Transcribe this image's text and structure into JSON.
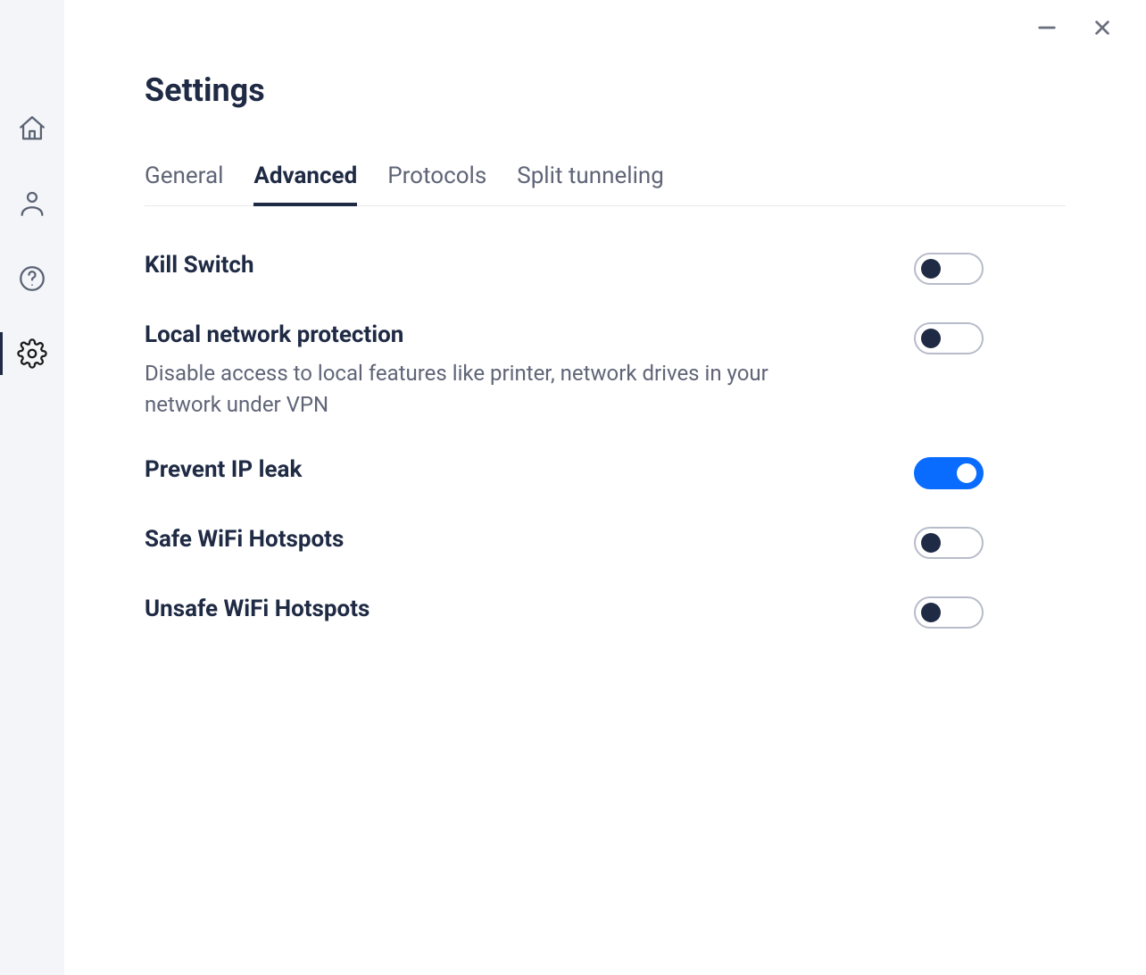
{
  "page": {
    "title": "Settings"
  },
  "tabs": {
    "general": "General",
    "advanced": "Advanced",
    "protocols": "Protocols",
    "split_tunneling": "Split tunneling",
    "active": "advanced"
  },
  "settings": {
    "kill_switch": {
      "title": "Kill Switch",
      "on": false
    },
    "local_network": {
      "title": "Local network protection",
      "desc": "Disable access to local features like printer, network drives in your network under VPN",
      "on": false
    },
    "prevent_ip_leak": {
      "title": "Prevent IP leak",
      "on": true
    },
    "safe_wifi": {
      "title": "Safe WiFi Hotspots",
      "on": false
    },
    "unsafe_wifi": {
      "title": "Unsafe WiFi Hotspots",
      "on": false
    }
  },
  "sidebar": {
    "items": [
      "home",
      "account",
      "help",
      "settings"
    ],
    "active": "settings"
  }
}
